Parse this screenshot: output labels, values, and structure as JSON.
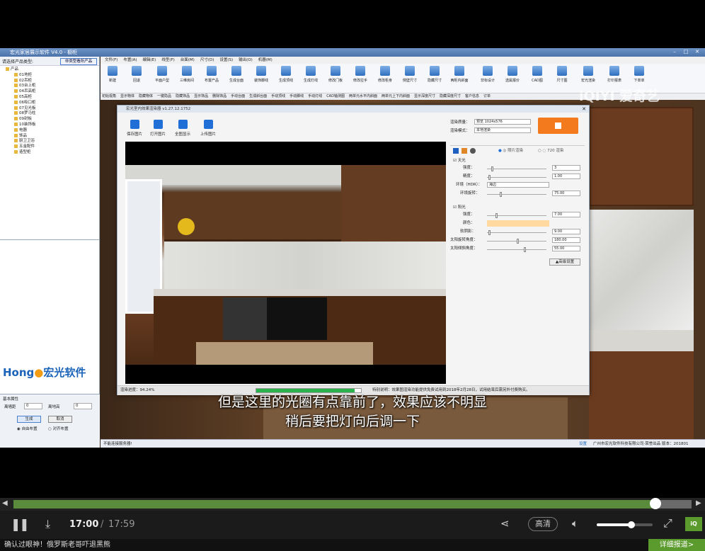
{
  "app": {
    "title": "宏光家居展示软件 V4.0 - 橱柜",
    "menu": [
      "文件(F)",
      "布置(A)",
      "编辑(E)",
      "线型(F)",
      "台面(M)",
      "尺寸(D)",
      "设置(S)",
      "输出(O)",
      "机器(M)"
    ],
    "toolbar": [
      "新建",
      "回退",
      "平面户型",
      "三维房间",
      "布置产品",
      "生成台面",
      "装饰脚线",
      "生成顶线",
      "生成灯线",
      "修改门板",
      "修改拉手",
      "修改柜身",
      "侧壁尺寸",
      "隐藏尺寸",
      "两柜内斜面",
      "非标设计",
      "选属报价",
      "CAD图",
      "尺寸图",
      "宏光渲染",
      "打印报表",
      "下单单"
    ],
    "toolbar2": [
      "初始视角",
      "显示物体",
      "隐藏物体",
      "一键隐品",
      "隐藏饰品",
      "显示饰品",
      "删除饰品",
      "手动台面",
      "生成斜台面",
      "手动顶线",
      "手动脚线",
      "手动灯线",
      "CAD轴测图",
      "两单元水平内斜面",
      "两单元上下内斜面",
      "显示深度尺寸",
      "隐藏深度尺寸",
      "客户信息",
      "订单"
    ],
    "status_left": "不能连接服务器!",
    "status_right": [
      "设置",
      "广州市宏光软件科技有限公司·荣誉出品 版本：201801"
    ]
  },
  "left_panel": {
    "header": "请选择产品类型:",
    "button": "非类型看所产品",
    "tree_root": "产品",
    "tree_items": [
      "01地柜",
      "02吊柜",
      "03台上柜",
      "04吊高柜",
      "05高柜",
      "06吸口柜",
      "07见光板",
      "08罗马柱",
      "09封板",
      "10装饰板",
      "电器",
      "饰品",
      "厨卫卫浴",
      "五金配件",
      "造型柜"
    ],
    "logo_en": "Hong",
    "logo_cn": "宏光软件",
    "props_title": "基本属性",
    "props_label1": "离墙距",
    "props_val1": "0",
    "props_label2": "离地高",
    "props_val2": "0",
    "btn_generate": "生成",
    "btn_cancel": "取消",
    "radio1": "自由布置",
    "radio2": "对齐布置"
  },
  "dialog": {
    "title": "宏光室内效果渲染器 v1.27.12.1752",
    "tools": [
      "保存图片",
      "打开图片",
      "全图显示",
      "上传图片"
    ],
    "quality_label": "渲染质量：",
    "quality_value": "预览 1024x576",
    "mode_label": "渲染模式：",
    "mode_value": "本地渲染",
    "photo_render": "照片渲染",
    "vr_render": "720 渲染",
    "skylight": "天光",
    "intensity_label": "强度：",
    "intensity_value": "3",
    "brightness_label": "精度：",
    "brightness_value": "1.00",
    "env_label": "环境（HDR）：",
    "env_value": "海边",
    "env_rot_label": "环境旋转：",
    "env_rot_value": "75.00",
    "sunlight": "阳光",
    "sun_intensity_label": "强度：",
    "sun_intensity_value": "7.00",
    "color_label": "颜色：",
    "color_value": "#ffd9a0",
    "softness_label": "软阴影：",
    "softness_value": "9.00",
    "sun_rot_label": "太阳旋转角度：",
    "sun_rot_value": "180.00",
    "sun_tilt_label": "太阳倾斜角度：",
    "sun_tilt_value": "55.00",
    "advanced": "▲高级设置",
    "progress_label": "渲染进度：94.24%",
    "progress": 0.9424,
    "notice": "特别说明：效果图渲染功能提供免费试用到2018年2月28日，试用结束后需另外付费购买。"
  },
  "subtitle": {
    "line1": "但是这里的光圈有点靠前了，效果应该不明显",
    "line2": "稍后要把灯向后调一下"
  },
  "watermark": "iQIYI 爱奇艺",
  "player": {
    "current_time": "17:00",
    "separator": "/",
    "total_time": "17:59",
    "progress": 0.947,
    "quality": "高清",
    "volume": 0.62,
    "ticker": "确认过眼神！俄罗斯老哥吓退黑熊",
    "detail_button": "详细报道>"
  }
}
